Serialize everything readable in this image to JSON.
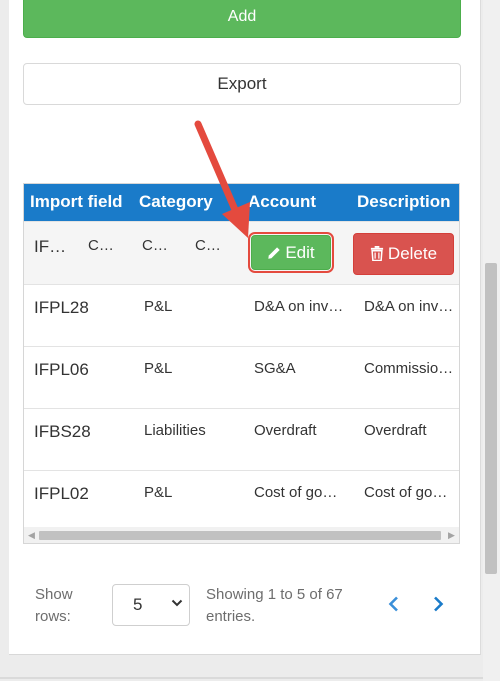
{
  "actions": {
    "add_label": "Add",
    "export_label": "Export"
  },
  "table": {
    "columns": [
      "Import field",
      "Category",
      "Account",
      "Description"
    ],
    "selected_row": {
      "import_field": "IF…",
      "category": "C…",
      "account": "C…",
      "description": "C…"
    },
    "row_actions": {
      "edit_label": "Edit",
      "delete_label": "Delete"
    },
    "rows": [
      {
        "import_field": "IFPL28",
        "category": "P&L",
        "account": "D&A on inv…",
        "description": "D&A on inv…"
      },
      {
        "import_field": "IFPL06",
        "category": "P&L",
        "account": "SG&A",
        "description": "Commissio…"
      },
      {
        "import_field": "IFBS28",
        "category": "Liabilities",
        "account": "Overdraft",
        "description": "Overdraft"
      },
      {
        "import_field": "IFPL02",
        "category": "P&L",
        "account": "Cost of go…",
        "description": "Cost of go…"
      }
    ]
  },
  "footer": {
    "show_rows_label": "Show rows:",
    "rows_per_page": "5",
    "entries_text": "Showing 1 to 5 of 67 entries."
  },
  "colors": {
    "header_bg": "#1a7bc9",
    "add_green": "#5cb85c",
    "delete_red": "#d9534f",
    "annotation_red": "#e44a3e",
    "pager_blue": "#3a8fd9"
  },
  "icons": {
    "edit": "pencil-icon",
    "delete": "trash-icon",
    "prev": "chevron-left-icon",
    "next": "chevron-right-icon",
    "select": "chevron-down-icon"
  }
}
